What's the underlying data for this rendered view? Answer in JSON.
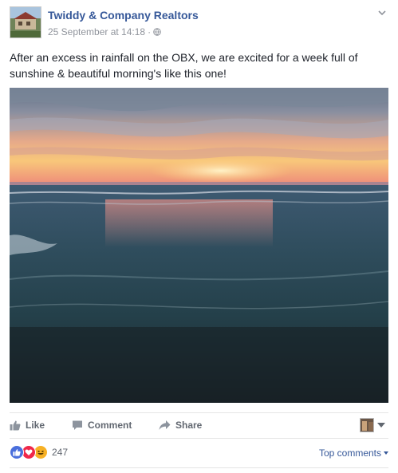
{
  "post": {
    "page_name": "Twiddy & Company Realtors",
    "timestamp": "25 September at 14:18",
    "separator": "·",
    "privacy_icon": "globe-icon",
    "text": "After an excess in rainfall on the OBX, we are excited for a week full of sunshine & beautiful morning's like this one!"
  },
  "actions": {
    "like_label": "Like",
    "comment_label": "Comment",
    "share_label": "Share"
  },
  "reactions": {
    "icons": [
      "like-icon",
      "love-icon",
      "haha-icon"
    ],
    "count": "247"
  },
  "comments": {
    "sort_label": "Top comments"
  },
  "colors": {
    "link_blue": "#365899",
    "meta_grey": "#90949c",
    "action_grey": "#616770"
  }
}
